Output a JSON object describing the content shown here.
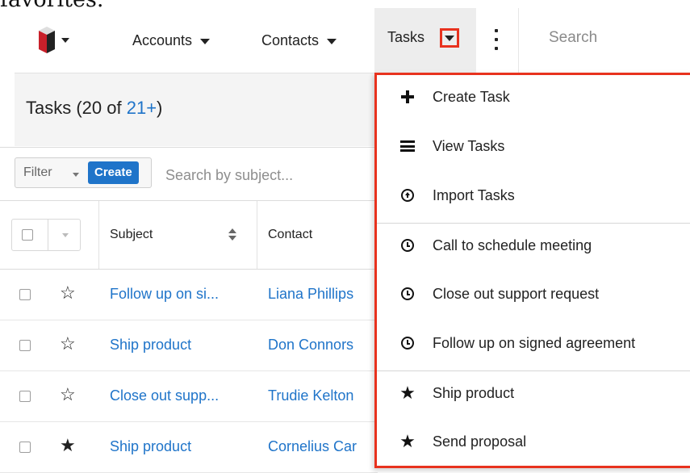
{
  "caption": "favorites.",
  "nav": {
    "accounts": "Accounts",
    "contacts": "Contacts",
    "tasks": "Tasks",
    "search_placeholder": "Search"
  },
  "list": {
    "title_prefix": "Tasks (20 of ",
    "count_link": "21+",
    "title_suffix": ")",
    "filter_label": "Filter",
    "create_label": "Create",
    "search_placeholder": "Search by subject..."
  },
  "table": {
    "columns": [
      "Subject",
      "Contact"
    ],
    "rows": [
      {
        "subject": "Follow up on si...",
        "contact": "Liana Phillips",
        "favorite": false
      },
      {
        "subject": "Ship product",
        "contact": "Don Connors",
        "favorite": false
      },
      {
        "subject": "Close out supp...",
        "contact": "Trudie Kelton",
        "favorite": false
      },
      {
        "subject": "Ship product",
        "contact": "Cornelius Car",
        "favorite": true
      }
    ]
  },
  "dropdown": {
    "items": [
      {
        "label": "Create Task",
        "icon": "plus-icon"
      },
      {
        "label": "View Tasks",
        "icon": "list-icon"
      },
      {
        "label": "Import Tasks",
        "icon": "upload-circle-icon"
      },
      {
        "label": "Call to schedule meeting",
        "icon": "clock-icon"
      },
      {
        "label": "Close out support request",
        "icon": "clock-icon"
      },
      {
        "label": "Follow up on signed agreement",
        "icon": "clock-icon"
      },
      {
        "label": "Ship product",
        "icon": "star-icon"
      },
      {
        "label": "Send proposal",
        "icon": "star-icon"
      }
    ]
  },
  "colors": {
    "link": "#1f74c9",
    "highlight": "#e8321e",
    "active_tab_bg": "#ededed"
  }
}
